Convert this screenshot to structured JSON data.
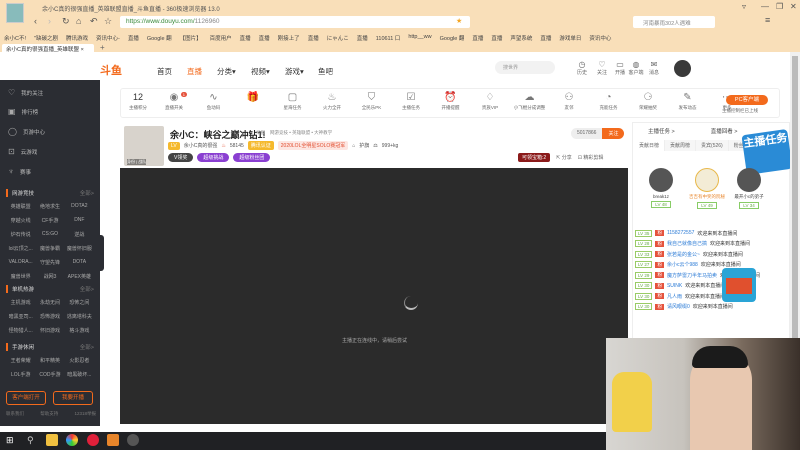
{
  "browser": {
    "title": "余小C真的很强直播_英雄联盟直播_斗鱼直播 - 360极速浏览器 13.0",
    "url_host": "https://www.douyu.com/",
    "url_path": "1126960",
    "search_placeholder": "河南暴雨302人遇难",
    "bookmarks": [
      "余小C不!",
      "\"缺碳之剧",
      "腾讯游戏",
      "资讯中心-",
      "直播",
      "Google 翻",
      "【图片】",
      "百度用户",
      "直播",
      "直播",
      "刚接上了",
      "直播",
      "にゃんこ",
      "直播",
      "110611 口",
      "http__ww",
      "Google 翻",
      "直播",
      "直播",
      "声望系统",
      "直播",
      "游戏单日",
      "资讯中心"
    ],
    "tab_label": "余小C真的很强直播_英雄联盟",
    "new_tab": "+"
  },
  "nav": {
    "logo": "斗鱼",
    "items": [
      "首页",
      "直播",
      "分类▾",
      "视频▾",
      "游戏▾",
      "鱼吧"
    ],
    "search_placeholder": "搜世界",
    "header_icons": [
      "历史",
      "关注",
      "开播",
      "客户端",
      "消息"
    ]
  },
  "sidebar": {
    "items": [
      "我的关注",
      "排行榜",
      "页游中心",
      "云游戏",
      "赛事"
    ],
    "sections": [
      {
        "title": "网游竞技",
        "more": "全部>",
        "games": [
          "英雄联盟",
          "绝地求生",
          "DOTA2",
          "穿越火线",
          "CF手游",
          "DNF",
          "炉石传说",
          "CS:GO",
          "逆战",
          "lol云顶之...",
          "魔兽争霸",
          "魔兽怀旧服",
          "VALORA...",
          "守望先锋",
          "DOTA",
          "魔兽世界",
          "战网3",
          "APEX英雄"
        ]
      },
      {
        "title": "单机热游",
        "more": "全部>",
        "games": [
          "主机游戏",
          "永劫无间",
          "恐怖之间",
          "暗黑亚司...",
          "恐怖游戏",
          "逃离塔科夫",
          "怪物猎人...",
          "怀旧游戏",
          "格斗游戏"
        ]
      },
      {
        "title": "手游休闲",
        "more": "全部>",
        "games": [
          "王者荣耀",
          "和平精英",
          "火影忍者",
          "LOL手游",
          "COD手游",
          "暗黑破坏..."
        ]
      }
    ],
    "buttons": [
      "客户端打开",
      "我要开播"
    ],
    "footer": [
      "联系我们",
      "帮助支持",
      "12318举报"
    ]
  },
  "toolbar": {
    "score": "12",
    "score_label": "主播积分",
    "items": [
      "直播开关",
      "鱼动码",
      "",
      "星海任务",
      "火力全开",
      "全民乐PK",
      "主播任务",
      "开播提醒",
      "贵族VIP",
      "小飞棍分成调整",
      "友邻",
      "充能任务",
      "荣耀抽奖",
      "发布动态",
      "更多"
    ],
    "badge": "1",
    "pc_button": "PC客户端",
    "pc_sub": "主播控制栏已上线"
  },
  "streamer": {
    "title": "余小C：峡谷之巅冲钻1!",
    "report": "举报",
    "category": "网游竞技 • 英雄联盟 • 大神教学",
    "level": "LV",
    "name": "余小C真的很强",
    "hot": "58145",
    "badge1": "腾讯认证",
    "badge2": "2020LOL全明星SOLO赛冠军",
    "role": "护旗",
    "weight": "999+kg",
    "tag_dark": "V领奖",
    "tag_p1": "超级挑战",
    "tag_p2": "超级粉丝团",
    "avatar_caption": "身份 | 战队",
    "followers": "5017866",
    "follow": "关注",
    "gift_tag": "可领宝箱:2",
    "share": "分享",
    "clip": "精彩剪辑"
  },
  "video": {
    "status": "主播正在连线中，请稍后尝试"
  },
  "chat": {
    "top_links": [
      "主播任务 >",
      "直播回看 >"
    ],
    "tabs": [
      "贡献日榜",
      "贡献周榜",
      "贵宾(526)",
      "粉丝"
    ],
    "task_badge": "主播任务",
    "ranks": [
      {
        "name": "break1z",
        "lv": "LV 48"
      },
      {
        "name": "吉吉有中奖的阮秘",
        "lv": "LV 49"
      },
      {
        "name": "最开小c的弟子",
        "lv": "LV 34"
      }
    ],
    "messages": [
      {
        "lv": "LV 35",
        "user": "1158272557",
        "text": "欢迎来到本直播间"
      },
      {
        "lv": "LV 28",
        "user": "我自己就像自己搞",
        "text": "欢迎来到本直播间"
      },
      {
        "lv": "LV 33",
        "user": "张若是的金公~",
        "text": "欢迎来到本直播间"
      },
      {
        "lv": "LV 27",
        "user": "余小c云个988",
        "text": "欢迎来到本直播间"
      },
      {
        "lv": "LV 29",
        "user": "魔方萨雷刀半年马拍卖",
        "text": "欢迎来到本直播间"
      },
      {
        "lv": "LV 30",
        "user": "SUINK",
        "text": "欢迎来到本直播间"
      },
      {
        "lv": "LV 30",
        "user": "凡人雨",
        "text": "欢迎来到本直播间"
      },
      {
        "lv": "LV 30",
        "user": "请风眼缀0",
        "text": "欢迎来到本直播间"
      }
    ],
    "fan_badge": "粉"
  },
  "colors": {
    "accent": "#f36a1c",
    "sidebar": "#2b2d33",
    "chrome": "#f9dfb9"
  }
}
